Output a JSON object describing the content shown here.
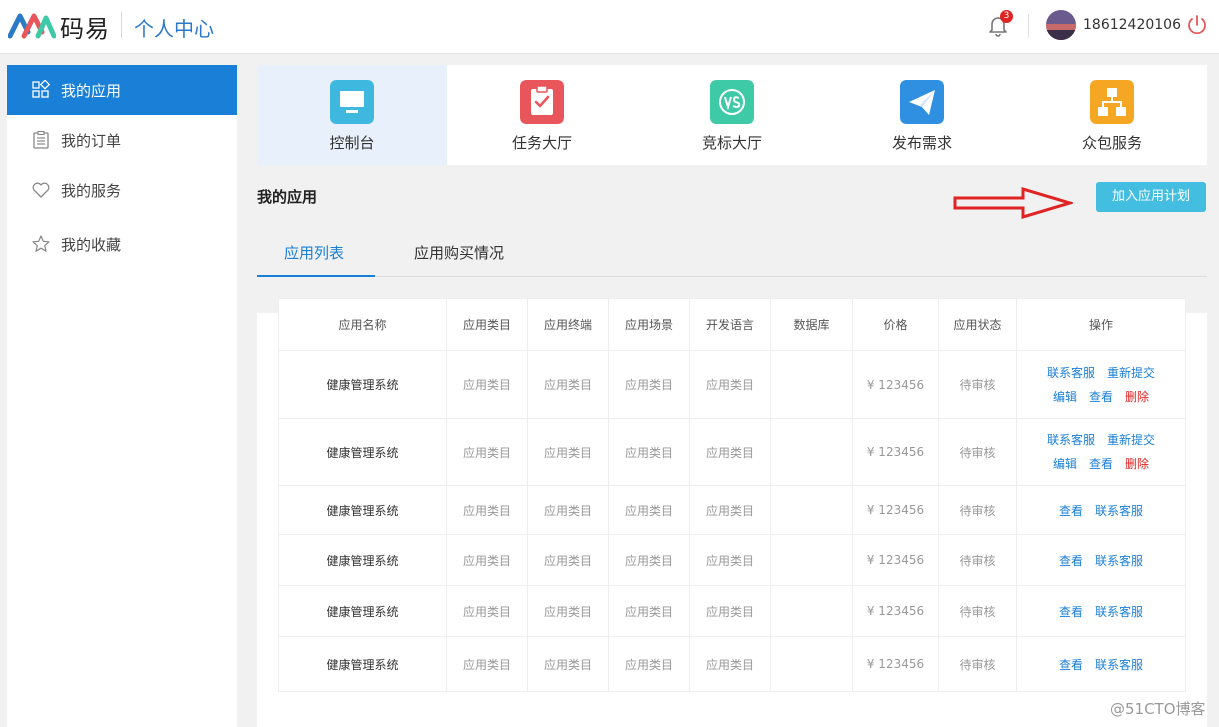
{
  "header": {
    "brand": "码易",
    "title": "个人中心",
    "notification_count": "3",
    "username": "18612420106"
  },
  "sidebar": {
    "items": [
      {
        "label": "我的应用",
        "icon": "grid-icon"
      },
      {
        "label": "我的订单",
        "icon": "clipboard-icon"
      },
      {
        "label": "我的服务",
        "icon": "heart-icon"
      },
      {
        "label": "我的收藏",
        "icon": "star-icon"
      }
    ]
  },
  "quicknav": {
    "items": [
      {
        "label": "控制台",
        "icon": "monitor-icon",
        "color": "#3fb8df"
      },
      {
        "label": "任务大厅",
        "icon": "task-clipboard-icon",
        "color": "#e8555a"
      },
      {
        "label": "竞标大厅",
        "icon": "vs-icon",
        "color": "#3ec9a7"
      },
      {
        "label": "发布需求",
        "icon": "paper-plane-icon",
        "color": "#2f8fe0"
      },
      {
        "label": "众包服务",
        "icon": "org-chart-icon",
        "color": "#f5a623"
      }
    ]
  },
  "section": {
    "title": "我的应用",
    "join_button": "加入应用计划"
  },
  "tabs": [
    "应用列表",
    "应用购买情况"
  ],
  "table": {
    "headers": [
      "应用名称",
      "应用类目",
      "应用终端",
      "应用场景",
      "开发语言",
      "数据库",
      "价格",
      "应用状态",
      "操作"
    ],
    "rows": [
      {
        "name": "健康管理系统",
        "category": "应用类目",
        "terminal": "应用类目",
        "scene": "应用类目",
        "language": "应用类目",
        "db": "",
        "price": "¥ 123456",
        "status": "待审核",
        "ops": [
          "联系客服",
          "重新提交",
          "编辑",
          "查看",
          "删除"
        ]
      },
      {
        "name": "健康管理系统",
        "category": "应用类目",
        "terminal": "应用类目",
        "scene": "应用类目",
        "language": "应用类目",
        "db": "",
        "price": "¥ 123456",
        "status": "待审核",
        "ops": [
          "联系客服",
          "重新提交",
          "编辑",
          "查看",
          "删除"
        ]
      },
      {
        "name": "健康管理系统",
        "category": "应用类目",
        "terminal": "应用类目",
        "scene": "应用类目",
        "language": "应用类目",
        "db": "",
        "price": "¥ 123456",
        "status": "待审核",
        "ops": [
          "查看",
          "联系客服"
        ]
      },
      {
        "name": "健康管理系统",
        "category": "应用类目",
        "terminal": "应用类目",
        "scene": "应用类目",
        "language": "应用类目",
        "db": "",
        "price": "¥ 123456",
        "status": "待审核",
        "ops": [
          "查看",
          "联系客服"
        ]
      },
      {
        "name": "健康管理系统",
        "category": "应用类目",
        "terminal": "应用类目",
        "scene": "应用类目",
        "language": "应用类目",
        "db": "",
        "price": "¥ 123456",
        "status": "待审核",
        "ops": [
          "查看",
          "联系客服"
        ]
      },
      {
        "name": "健康管理系统",
        "category": "应用类目",
        "terminal": "应用类目",
        "scene": "应用类目",
        "language": "应用类目",
        "db": "",
        "price": "¥ 123456",
        "status": "待审核",
        "ops": [
          "查看",
          "联系客服"
        ]
      }
    ]
  },
  "watermark": "@51CTO博客",
  "colors": {
    "primary": "#1a7fd6",
    "join_button": "#43bde0",
    "danger": "#e02323",
    "annotation_arrow": "#e02323"
  }
}
